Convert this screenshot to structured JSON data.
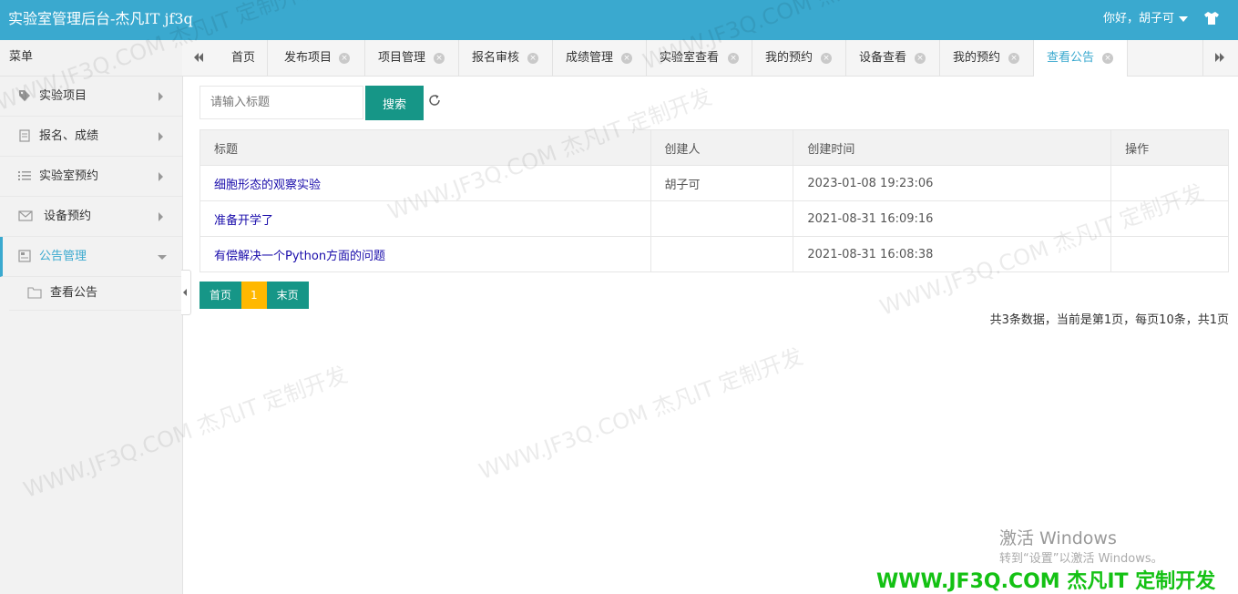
{
  "header": {
    "title": "实验室管理后台-杰凡IT jf3q",
    "greeting": "你好，胡子可"
  },
  "sidebar": {
    "menu_title": "菜单",
    "items": [
      {
        "label": "实验项目",
        "icon": "tag-icon"
      },
      {
        "label": "报名、成绩",
        "icon": "document-icon"
      },
      {
        "label": "实验室预约",
        "icon": "list-icon"
      },
      {
        "label": "设备预约",
        "icon": "mail-icon"
      },
      {
        "label": "公告管理",
        "icon": "notice-icon",
        "active": true
      }
    ],
    "sub_items": [
      {
        "label": "查看公告",
        "icon": "folder-icon"
      }
    ]
  },
  "tabs": [
    {
      "label": "首页"
    },
    {
      "label": "发布项目"
    },
    {
      "label": "项目管理"
    },
    {
      "label": "报名审核"
    },
    {
      "label": "成绩管理"
    },
    {
      "label": "实验室查看"
    },
    {
      "label": "我的预约"
    },
    {
      "label": "设备查看"
    },
    {
      "label": "我的预约"
    },
    {
      "label": "查看公告",
      "active": true
    }
  ],
  "search": {
    "placeholder": "请输入标题",
    "button_label": "搜索"
  },
  "table": {
    "headers": [
      "标题",
      "创建人",
      "创建时间",
      "操作"
    ],
    "rows": [
      {
        "title": "细胞形态的观察实验",
        "creator": "胡子可",
        "created": "2023-01-08 19:23:06",
        "action": ""
      },
      {
        "title": "准备开学了",
        "creator": "",
        "created": "2021-08-31 16:09:16",
        "action": ""
      },
      {
        "title": "有偿解决一个Python方面的问题",
        "creator": "",
        "created": "2021-08-31 16:08:38",
        "action": ""
      }
    ]
  },
  "pager": {
    "first": "首页",
    "current": "1",
    "last": "末页",
    "info": "共3条数据，当前是第1页，每页10条，共1页"
  },
  "overlay": {
    "watermark": "WWW.JF3Q.COM 杰凡IT 定制开发",
    "activate_title": "激活 Windows",
    "activate_sub": "转到“设置”以激活 Windows。",
    "brand": "WWW.JF3Q.COM 杰凡IT  定制开发"
  },
  "colors": {
    "header": "#3aa9cf",
    "primary_button": "#169687",
    "current_page": "#ffb800"
  }
}
